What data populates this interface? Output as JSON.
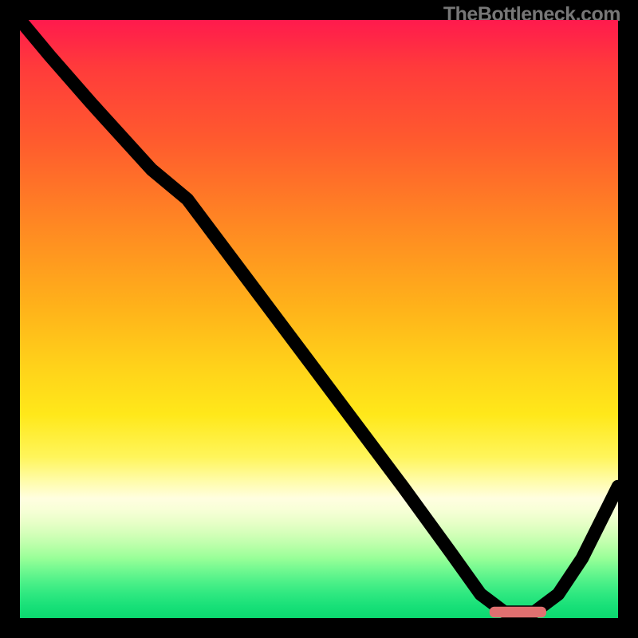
{
  "watermark": "TheBottleneck.com",
  "chart_data": {
    "type": "line",
    "title": "",
    "xlabel": "",
    "ylabel": "",
    "xlim": [
      0,
      100
    ],
    "ylim": [
      0,
      100
    ],
    "grid": false,
    "legend": false,
    "series": [
      {
        "name": "bottleneck-curve",
        "x": [
          0,
          5,
          12,
          22,
          28,
          40,
          52,
          64,
          72,
          77,
          81,
          86,
          90,
          94,
          98,
          100
        ],
        "y": [
          100,
          94,
          86,
          75,
          70,
          54,
          38,
          22,
          11,
          4,
          1,
          1,
          4,
          10,
          18,
          22
        ]
      }
    ],
    "marker": {
      "name": "optimal-range",
      "x_start": 78.5,
      "x_end": 88,
      "y": 1,
      "color": "#e07070"
    },
    "background_gradient": {
      "stops": [
        {
          "pos": 0.0,
          "color": "#ff1a4d"
        },
        {
          "pos": 0.2,
          "color": "#ff5a2e"
        },
        {
          "pos": 0.48,
          "color": "#ffb21a"
        },
        {
          "pos": 0.73,
          "color": "#fff55a"
        },
        {
          "pos": 0.82,
          "color": "#f7ffd6"
        },
        {
          "pos": 1.0,
          "color": "#0bd86f"
        }
      ]
    }
  }
}
